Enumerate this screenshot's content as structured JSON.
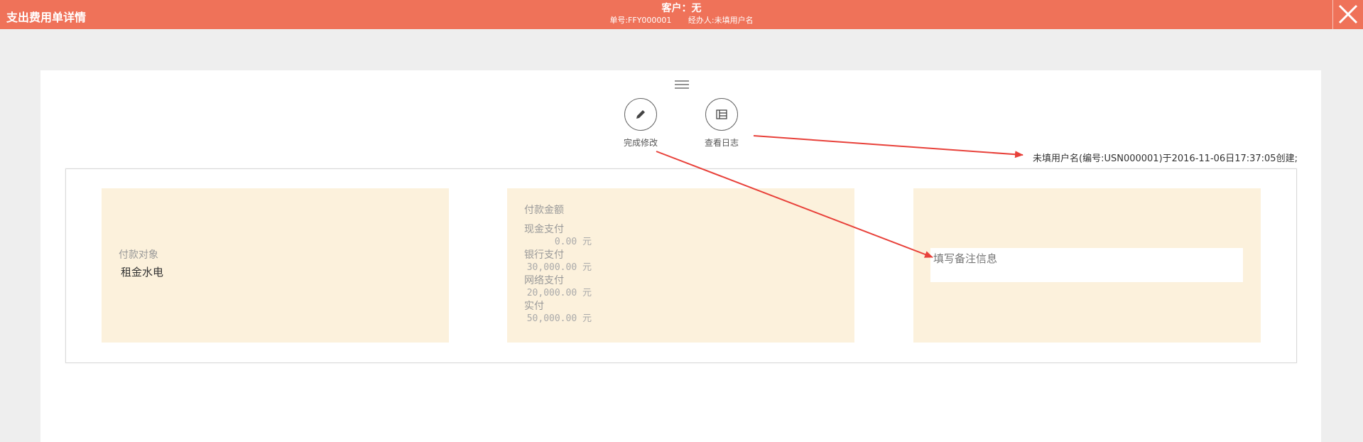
{
  "header": {
    "title": "支出费用单详情",
    "customer": "客户：无",
    "order_no": "单号:FFY000001",
    "handler": "经办人:未填用户名"
  },
  "actions": {
    "finish_edit": "完成修改",
    "view_log": "查看日志"
  },
  "log_text": "未填用户名(编号:USN000001)于2016-11-06日17:37:05创建;",
  "payee": {
    "label": "付款对象",
    "value": "租金水电"
  },
  "payment": {
    "title": "付款金额",
    "items": [
      {
        "label": "现金支付",
        "amount": "0.00 元"
      },
      {
        "label": "银行支付",
        "amount": "30,000.00 元"
      },
      {
        "label": "网络支付",
        "amount": "20,000.00 元"
      },
      {
        "label": "实付",
        "amount": "50,000.00 元"
      }
    ]
  },
  "remark": {
    "placeholder": "填写备注信息"
  },
  "colors": {
    "header": "#ef7259",
    "panel": "#fcf1dc",
    "arrow": "#e8413a"
  }
}
